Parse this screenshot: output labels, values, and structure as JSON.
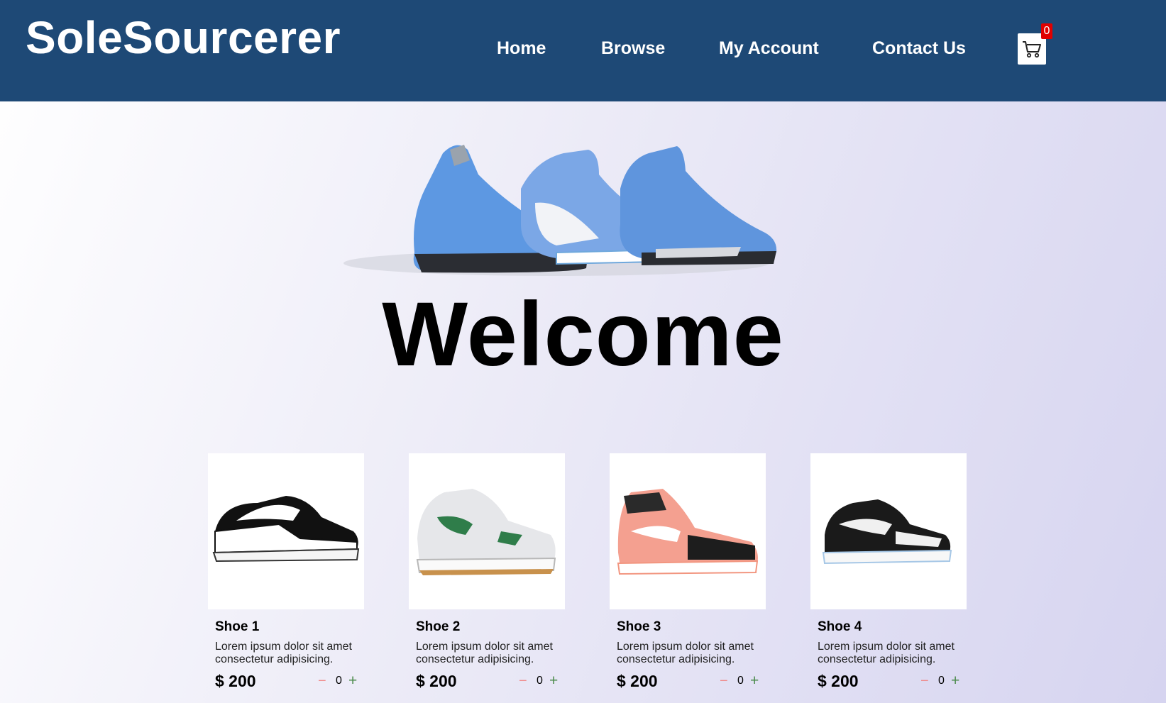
{
  "header": {
    "logo": "SoleSourcerer",
    "nav": [
      {
        "label": "Home"
      },
      {
        "label": "Browse"
      },
      {
        "label": "My Account"
      },
      {
        "label": "Contact Us"
      }
    ],
    "cart_count": "0",
    "cart_icon": "shopping-cart-icon"
  },
  "hero": {
    "title": "Welcome"
  },
  "products": [
    {
      "name": "Shoe 1",
      "description": "Lorem ipsum dolor sit amet consectetur adipisicing.",
      "price": "$ 200",
      "quantity": "0",
      "minus": "−",
      "plus": "+"
    },
    {
      "name": "Shoe 2",
      "description": "Lorem ipsum dolor sit amet consectetur adipisicing.",
      "price": "$ 200",
      "quantity": "0",
      "minus": "−",
      "plus": "+"
    },
    {
      "name": "Shoe 3",
      "description": "Lorem ipsum dolor sit amet consectetur adipisicing.",
      "price": "$ 200",
      "quantity": "0",
      "minus": "−",
      "plus": "+"
    },
    {
      "name": "Shoe 4",
      "description": "Lorem ipsum dolor sit amet consectetur adipisicing.",
      "price": "$ 200",
      "quantity": "0",
      "minus": "−",
      "plus": "+"
    }
  ],
  "colors": {
    "header_bg": "#1e4976",
    "badge": "#e00000"
  }
}
